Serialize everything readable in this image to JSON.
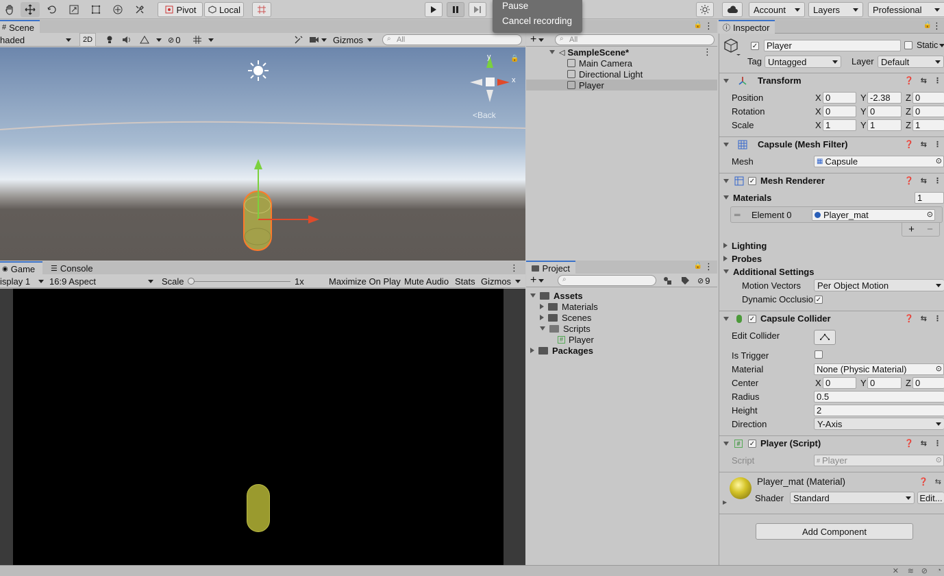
{
  "toolbar": {
    "pivot_label": "Pivot",
    "local_label": "Local",
    "account_label": "Account",
    "layers_label": "Layers",
    "layout_label": "Professional"
  },
  "recording_menu": {
    "items": [
      "Pause",
      "Cancel recording"
    ]
  },
  "scene": {
    "tab_label": "Scene",
    "shading_mode": "haded",
    "mode_2d": "2D",
    "hidden_count": "0",
    "gizmos_label": "Gizmos",
    "search_placeholder": "All",
    "back_label": "Back",
    "gizmo_x": "x",
    "gizmo_y": "y",
    "colors": {
      "sky_top": "#6c86ac",
      "horizon": "#e8eef4",
      "ground": "#5f5a56",
      "selection": "#ff7a2a"
    }
  },
  "game": {
    "tab_label": "Game",
    "console_tab_label": "Console",
    "display_label": "isplay 1",
    "aspect_label": "16:9 Aspect",
    "scale_label": "Scale",
    "scale_value": "1x",
    "maximize_label": "Maximize On Play",
    "mute_label": "Mute Audio",
    "stats_label": "Stats",
    "gizmos_label": "Gizmos"
  },
  "hierarchy": {
    "search_placeholder": "All",
    "scene_name": "SampleScene*",
    "items": [
      "Main Camera",
      "Directional Light",
      "Player"
    ],
    "selected": "Player"
  },
  "project": {
    "tab_label": "Project",
    "hidden_count": "9",
    "tree": {
      "assets": "Assets",
      "materials": "Materials",
      "scenes": "Scenes",
      "scripts": "Scripts",
      "player_script": "Player",
      "packages": "Packages"
    }
  },
  "inspector": {
    "tab_label": "Inspector",
    "object_name": "Player",
    "static_label": "Static",
    "tag_label": "Tag",
    "tag_value": "Untagged",
    "layer_label": "Layer",
    "layer_value": "Default",
    "transform": {
      "title": "Transform",
      "position_label": "Position",
      "rotation_label": "Rotation",
      "scale_label": "Scale",
      "position": {
        "x": "0",
        "y": "-2.38",
        "z": "0"
      },
      "rotation": {
        "x": "0",
        "y": "0",
        "z": "0"
      },
      "scale": {
        "x": "1",
        "y": "1",
        "z": "1"
      },
      "axis_x": "X",
      "axis_y": "Y",
      "axis_z": "Z"
    },
    "mesh_filter": {
      "title": "Capsule (Mesh Filter)",
      "mesh_label": "Mesh",
      "mesh_value": "Capsule"
    },
    "mesh_renderer": {
      "title": "Mesh Renderer",
      "materials_label": "Materials",
      "materials_count": "1",
      "element0_label": "Element 0",
      "element0_value": "Player_mat",
      "plus": "+",
      "minus": "−",
      "lighting_label": "Lighting",
      "probes_label": "Probes",
      "additional_label": "Additional Settings",
      "motion_vectors_label": "Motion Vectors",
      "motion_vectors_value": "Per Object Motion",
      "dynamic_occlusion_label": "Dynamic Occlusio"
    },
    "capsule_collider": {
      "title": "Capsule Collider",
      "edit_collider_label": "Edit Collider",
      "is_trigger_label": "Is Trigger",
      "material_label": "Material",
      "material_value": "None (Physic Material)",
      "center_label": "Center",
      "center": {
        "x": "0",
        "y": "0",
        "z": "0"
      },
      "radius_label": "Radius",
      "radius_value": "0.5",
      "height_label": "Height",
      "height_value": "2",
      "direction_label": "Direction",
      "direction_value": "Y-Axis"
    },
    "player_script": {
      "title": "Player (Script)",
      "script_label": "Script",
      "script_value": "Player"
    },
    "material_preview": {
      "title": "Player_mat (Material)",
      "shader_label": "Shader",
      "shader_value": "Standard",
      "edit_label": "Edit..."
    },
    "add_component_label": "Add Component"
  }
}
